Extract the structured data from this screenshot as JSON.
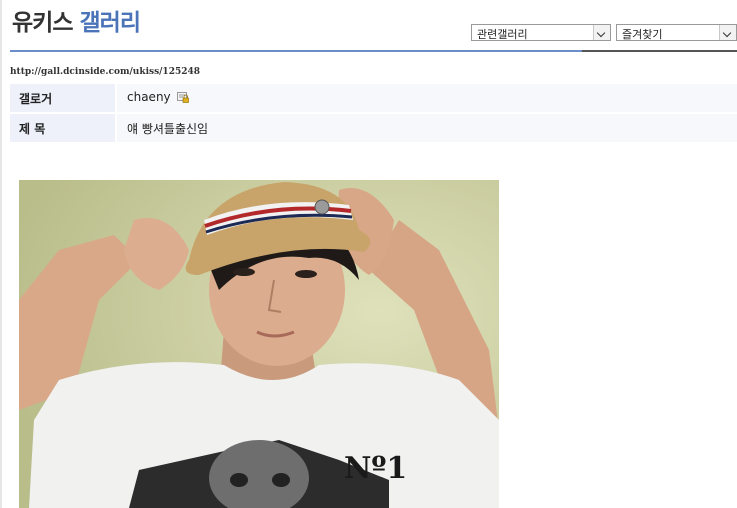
{
  "gallery": {
    "title_part1": "유키스",
    "title_part2": "갤러리"
  },
  "controls": {
    "related_gallery": "관련갤러리",
    "favorites": "즐겨찾기"
  },
  "post": {
    "url": "http://gall.dcinside.com/ukiss/125248",
    "author_label": "갤로거",
    "author": "chaeny",
    "subject_label": "제 목",
    "subject": "얘 빵셔틀출신임"
  },
  "image": {
    "shirt_text": "Nº1"
  },
  "icons": {
    "author_icon": "lock-icon",
    "dropdown_icon": "chevron-down-icon"
  },
  "colors": {
    "accent": "#4a73b8",
    "rule": "#6b8ec8",
    "label_bg": "#eef1fa"
  }
}
